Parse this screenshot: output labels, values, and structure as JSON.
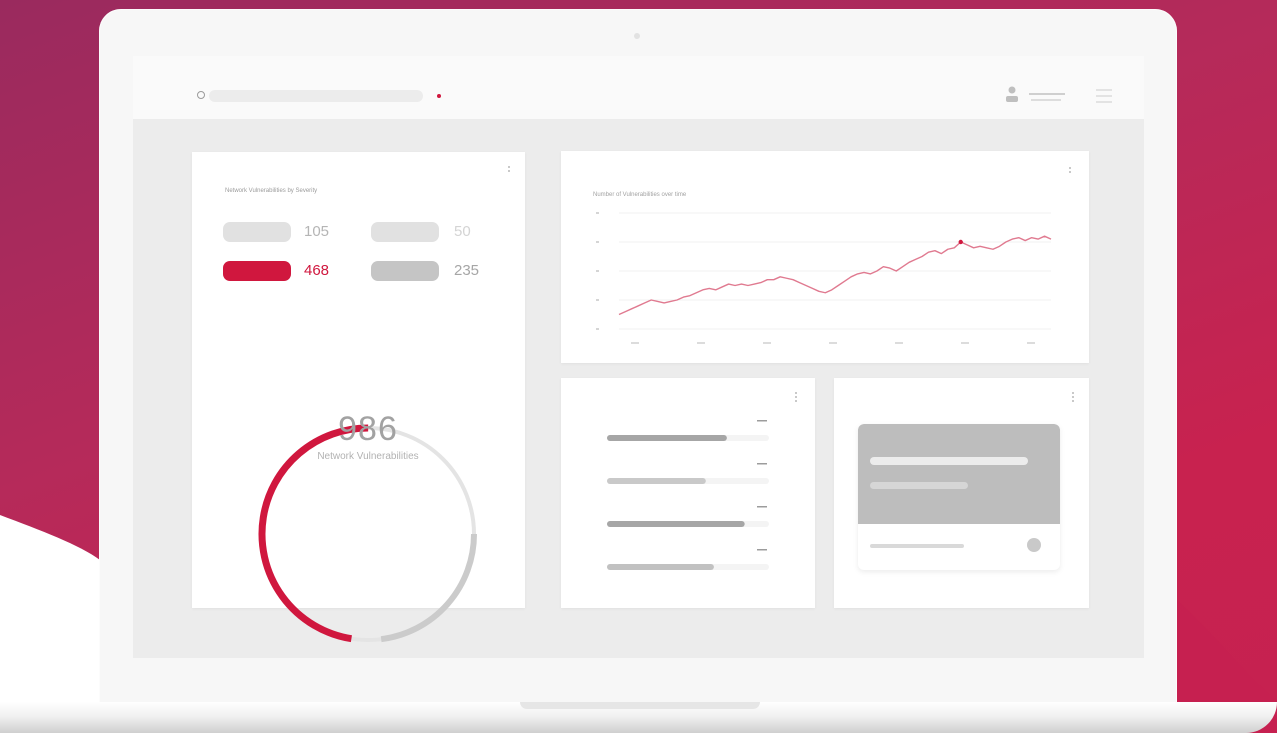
{
  "colors": {
    "accent": "#d0173e",
    "neutral_light": "#e1e1e1",
    "neutral_mid": "#c5c5c5",
    "neutral_dark": "#a9a9a9"
  },
  "topbar": {
    "search_icon": "search-icon",
    "user_icon": "user-icon",
    "menu_icon": "hamburger-menu-icon"
  },
  "vulnerability_card": {
    "title": "Network Vulnerabilities by Severity",
    "severities": [
      {
        "value": "105",
        "color": "#e1e1e1",
        "text_color": "#b5b5b5"
      },
      {
        "value": "50",
        "color": "#e1e1e1",
        "text_color": "#d4d4d4"
      },
      {
        "value": "468",
        "color": "#d0173e",
        "text_color": "#d0173e"
      },
      {
        "value": "235",
        "color": "#c5c5c5",
        "text_color": "#a6a6a6"
      }
    ],
    "total": "986",
    "total_label": "Network Vulnerabilities",
    "accent_fraction": 0.475
  },
  "trend_card": {
    "title": "Number of Vulnerabilities over time"
  },
  "chart_data": {
    "type": "line",
    "x": [
      0,
      1,
      2,
      3,
      4,
      5,
      6,
      7,
      8,
      9,
      10,
      11,
      12,
      13,
      14,
      15,
      16,
      17,
      18,
      19,
      20,
      21,
      22,
      23,
      24,
      25,
      26,
      27,
      28,
      29,
      30,
      31,
      32,
      33,
      34,
      35,
      36,
      37,
      38,
      39,
      40,
      41,
      42,
      43,
      44,
      45,
      46,
      47,
      48,
      49,
      50,
      51,
      52,
      53,
      54,
      55,
      56,
      57,
      58,
      59,
      60,
      61,
      62,
      63,
      64,
      65,
      66,
      67
    ],
    "series": [
      {
        "color": "#e07a90",
        "values": [
          10,
          12,
          14,
          16,
          18,
          20,
          19,
          18,
          19,
          20,
          22,
          23,
          25,
          27,
          28,
          27,
          29,
          31,
          30,
          31,
          30,
          31,
          32,
          34,
          34,
          36,
          35,
          34,
          32,
          30,
          28,
          26,
          25,
          27,
          30,
          33,
          36,
          38,
          39,
          38,
          40,
          43,
          42,
          40,
          43,
          46,
          48,
          50,
          53,
          54,
          52,
          55,
          56,
          60,
          58,
          56,
          57,
          56,
          55,
          57,
          60,
          62,
          63,
          61,
          63,
          62,
          64,
          62
        ]
      }
    ],
    "ylim": [
      0,
      80
    ],
    "grid": true,
    "legend": "none"
  },
  "bars_card": {
    "rows": [
      {
        "fill": 0.74,
        "color": "#a6a6a6"
      },
      {
        "fill": 0.61,
        "color": "#c9c9c9"
      },
      {
        "fill": 0.85,
        "color": "#a6a6a6"
      },
      {
        "fill": 0.66,
        "color": "#c1c1c1"
      }
    ]
  },
  "info_card": {
    "status_icon": "circle-status-icon"
  },
  "kebab_icon": "more-vertical-icon"
}
